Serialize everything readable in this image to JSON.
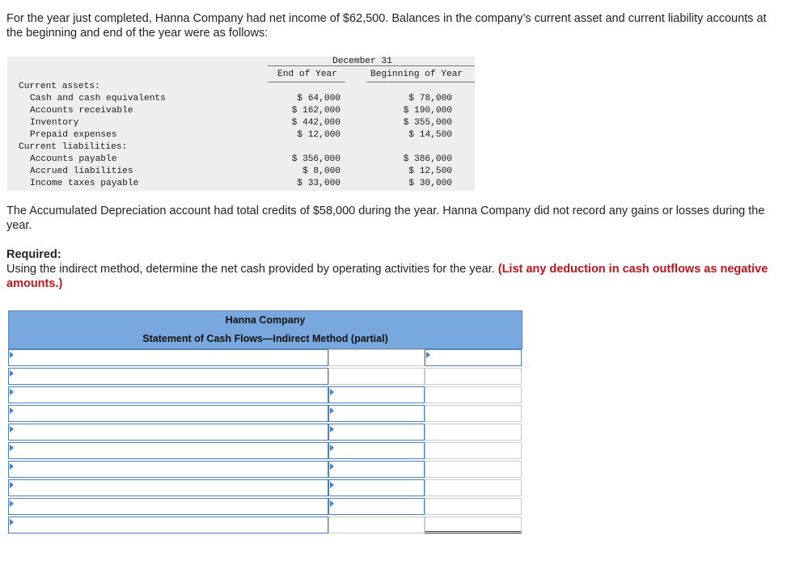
{
  "intro": "For the year just completed, Hanna Company had net income of $62,500. Balances in the company’s current asset and current liability accounts at the beginning and end of the year were as follows:",
  "balances": {
    "group_header": "December 31",
    "col_end": "End of Year",
    "col_begin": "Beginning of Year",
    "current_assets_label": "Current assets:",
    "current_liabilities_label": "Current liabilities:",
    "assets": [
      {
        "label": "Cash and cash equivalents",
        "end": "$ 64,000",
        "begin": "$ 78,000"
      },
      {
        "label": "Accounts receivable",
        "end": "$ 162,000",
        "begin": "$ 190,000"
      },
      {
        "label": "Inventory",
        "end": "$ 442,000",
        "begin": "$ 355,000"
      },
      {
        "label": "Prepaid expenses",
        "end": "$ 12,000",
        "begin": "$ 14,500"
      }
    ],
    "liabilities": [
      {
        "label": "Accounts payable",
        "end": "$ 356,000",
        "begin": "$ 386,000"
      },
      {
        "label": "Accrued liabilities",
        "end": "$ 8,000",
        "begin": "$ 12,500"
      },
      {
        "label": "Income taxes payable",
        "end": "$ 33,000",
        "begin": "$ 30,000"
      }
    ]
  },
  "depreciation_text": "The Accumulated Depreciation account had total credits of $58,000 during the year. Hanna Company did not record any gains or losses during the year.",
  "required_label": "Required:",
  "required_text": "Using the indirect method, determine the net cash provided by operating activities for the year.",
  "required_note": "(List any deduction in cash outflows as negative amounts.)",
  "statement": {
    "company": "Hanna Company",
    "title": "Statement of Cash Flows—Indirect Method (partial)"
  }
}
